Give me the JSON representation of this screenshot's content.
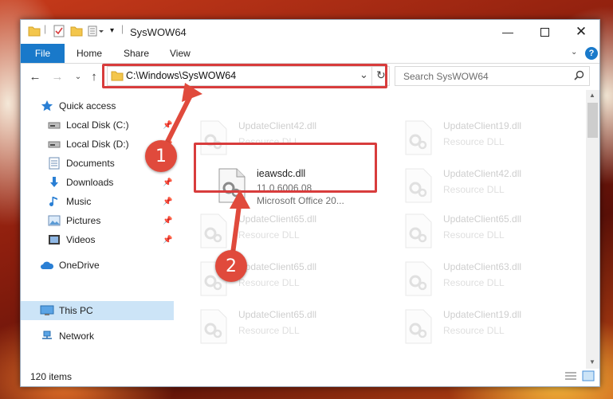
{
  "window": {
    "title": "SysWOW64"
  },
  "ribbon": {
    "tabs": [
      "File",
      "Home",
      "Share",
      "View"
    ]
  },
  "address": {
    "path": "C:\\Windows\\SysWOW64"
  },
  "search": {
    "placeholder": "Search SysWOW64"
  },
  "sidebar": {
    "items": [
      {
        "label": "Quick access",
        "icon": "star-icon"
      },
      {
        "label": "Local Disk (C:)",
        "icon": "drive-icon",
        "pinned": true
      },
      {
        "label": "Local Disk (D:)",
        "icon": "drive-icon",
        "pinned": true
      },
      {
        "label": "Documents",
        "icon": "documents-icon",
        "pinned": true
      },
      {
        "label": "Downloads",
        "icon": "downloads-icon",
        "pinned": true
      },
      {
        "label": "Music",
        "icon": "music-icon",
        "pinned": true
      },
      {
        "label": "Pictures",
        "icon": "pictures-icon",
        "pinned": true
      },
      {
        "label": "Videos",
        "icon": "videos-icon",
        "pinned": true
      },
      {
        "label": "OneDrive",
        "icon": "cloud-icon"
      },
      {
        "label": "This PC",
        "icon": "pc-icon",
        "selected": true
      },
      {
        "label": "Network",
        "icon": "network-icon"
      }
    ]
  },
  "files": {
    "highlighted": {
      "name": "ieawsdc.dll",
      "version": "11.0.6006.08",
      "company": "Microsoft Office 20..."
    },
    "faded": [
      {
        "name": "UpdateClient42.dll",
        "desc": "Resource DLL"
      },
      {
        "name": "UpdateClient19.dll",
        "desc": "Resource DLL"
      },
      {
        "name": "UpdateClient42.dll",
        "desc": "Resource DLL"
      },
      {
        "name": "UpdateClient65.dll",
        "desc": "Resource DLL"
      },
      {
        "name": "UpdateClient65.dll",
        "desc": "Resource DLL"
      },
      {
        "name": "UpdateClient65.dll",
        "desc": "Resource DLL"
      },
      {
        "name": "UpdateClient65.dll",
        "desc": "Resource DLL"
      },
      {
        "name": "UpdateClient63.dll",
        "desc": "Resource DLL"
      },
      {
        "name": "UpdateClient65.dll",
        "desc": "Resource DLL"
      },
      {
        "name": "UpdateClient19.dll",
        "desc": "Resource DLL"
      }
    ]
  },
  "status": {
    "items": "120 items"
  },
  "annotations": {
    "step1": "1",
    "step2": "2"
  },
  "colors": {
    "accent": "#1979ca",
    "highlight": "#d83c3c",
    "badge": "#e04a3c"
  }
}
